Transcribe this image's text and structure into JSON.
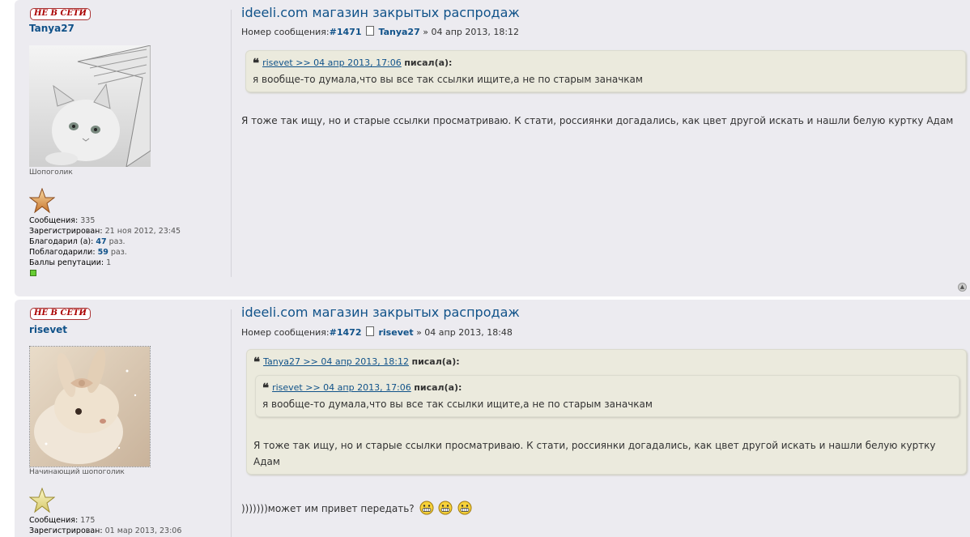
{
  "posts": [
    {
      "status": "НЕ В СЕТИ",
      "username": "Tanya27",
      "rank": "Шопоголик",
      "stats": {
        "messages_label": "Сообщения:",
        "messages": "335",
        "registered_label": "Зарегистрирован:",
        "registered": "21 ноя 2012, 23:45",
        "thanked_label": "Благодарил (а):",
        "thanked": "47",
        "thanked_suffix": "раз.",
        "thanks_label": "Поблагодарили:",
        "thanks": "59",
        "thanks_suffix": "раз.",
        "rep_label": "Баллы репутации:",
        "rep": "1"
      },
      "title": "ideeli.com магазин закрытых распродаж",
      "meta": {
        "label": "Номер сообщения:",
        "number": "#1471",
        "author": "Tanya27",
        "date": "» 04 апр 2013, 18:12"
      },
      "quote": {
        "link": "risevet >> 04 апр 2013, 17:06",
        "wrote": "писал(а):",
        "text": "я вообще-то думала,что вы все так ссылки ищите,а не по старым заначкам"
      },
      "text": "Я тоже так ищу, но и старые ссылки просматриваю. К стати, россиянки догадались, как цвет другой искать и нашли белую куртку Адам"
    },
    {
      "status": "НЕ В СЕТИ",
      "username": "risevet",
      "rank": "Начинающий шопоголик",
      "stats": {
        "messages_label": "Сообщения:",
        "messages": "175",
        "registered_label": "Зарегистрирован:",
        "registered": "01 мар 2013, 23:06"
      },
      "title": "ideeli.com магазин закрытых распродаж",
      "meta": {
        "label": "Номер сообщения:",
        "number": "#1472",
        "author": "risevet",
        "date": "» 04 апр 2013, 18:48"
      },
      "outer_quote": {
        "link": "Tanya27 >> 04 апр 2013, 18:12",
        "wrote": "писал(а):",
        "inner_link": "risevet >> 04 апр 2013, 17:06",
        "inner_wrote": "писал(а):",
        "inner_text": "я вообще-то думала,что вы все так ссылки ищите,а не по старым заначкам",
        "text_line1": "Я тоже так ищу, но и старые ссылки просматриваю. К стати, россиянки догадались, как цвет другой искать и нашли белую куртку",
        "text_line2": "Адам"
      },
      "text": ")))))))может им привет передать?"
    }
  ],
  "colors": {
    "link": "#105289",
    "post_bg": "#ecebf0",
    "quote_bg": "#ebeadd",
    "offline": "#aa0000"
  }
}
